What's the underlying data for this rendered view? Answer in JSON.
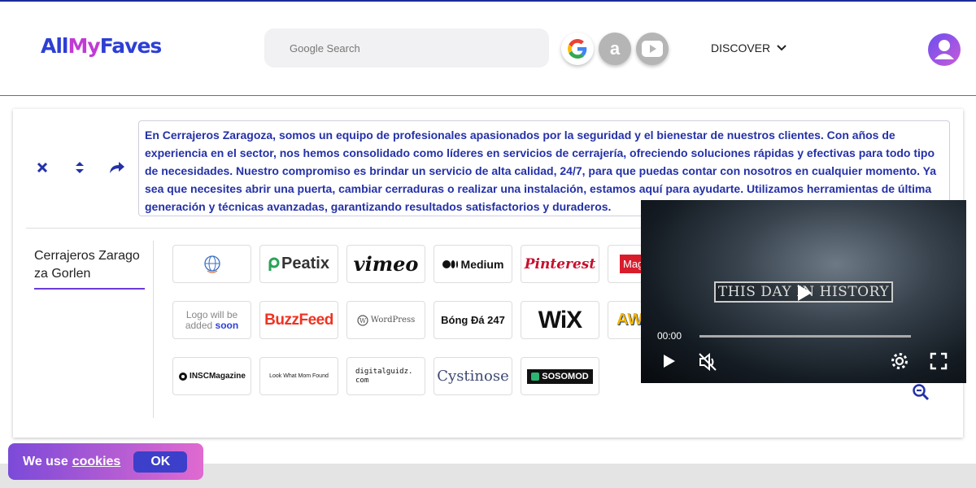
{
  "header": {
    "logo": {
      "part1": "All",
      "part2": "My",
      "part3": "Faves"
    },
    "search_placeholder": "Google Search",
    "engines": [
      {
        "name": "google",
        "icon": "google-icon"
      },
      {
        "name": "amazon",
        "icon": "amazon-icon"
      },
      {
        "name": "youtube",
        "icon": "youtube-icon"
      }
    ],
    "discover_label": "DISCOVER"
  },
  "card": {
    "tool_icons": [
      "close-icon",
      "sort-icon",
      "share-icon"
    ],
    "description": "En Cerrajeros Zaragoza, somos un equipo de profesionales apasionados por la seguridad y el bienestar de nuestros clientes. Con años de experiencia en el sector, nos hemos consolidado como líderes en servicios de cerrajería, ofreciendo soluciones rápidas y efectivas para todo tipo de necesidades. Nuestro compromiso es brindar un servicio de alta calidad, 24/7, para que puedas contar con nosotros en cualquier momento. Ya sea que necesites abrir una puerta, cambiar cerraduras o realizar una instalación, estamos aquí para ayudarte. Utilizamos herramientas de última generación y técnicas avanzadas, garantizando resultados satisfactorios y duraderos.",
    "tab_label": "Cerrajeros Zaragoza Gorlen",
    "tiles": [
      {
        "label": "",
        "kind": "globe"
      },
      {
        "label": "Peatix",
        "kind": "peatix"
      },
      {
        "label": "vimeo",
        "kind": "vimeo"
      },
      {
        "label": "Medium",
        "kind": "medium"
      },
      {
        "label": "Pinterest",
        "kind": "pinterest"
      },
      {
        "label": "Mag",
        "kind": "mag"
      },
      {
        "label": "Logo will be added soon",
        "kind": "placeholder",
        "line1": "Logo will be",
        "line2a": "added ",
        "line2b": "soon"
      },
      {
        "label": "BuzzFeed",
        "kind": "buzzfeed"
      },
      {
        "label": "WordPress",
        "kind": "wordpress"
      },
      {
        "label": "Bóng Đá 247",
        "kind": "bongda"
      },
      {
        "label": "WiX",
        "kind": "wix"
      },
      {
        "label": "AW",
        "kind": "aw"
      },
      {
        "label": "INSCMagazine",
        "kind": "insc"
      },
      {
        "label": "Look What Mom Found",
        "kind": "lwmf"
      },
      {
        "label": "digitalguidz.com",
        "kind": "digital"
      },
      {
        "label": "Cystinose",
        "kind": "cystinose"
      },
      {
        "label": "SOSOMOD",
        "kind": "sosomod"
      }
    ]
  },
  "video": {
    "title": "THIS DAY IN HISTORY",
    "time": "00:00",
    "progress": 0
  },
  "cookie": {
    "text": "We use",
    "link": "cookies",
    "ok": "OK"
  },
  "colors": {
    "brand_blue": "#2d3fd4",
    "brand_purple": "#c03bd6",
    "description_text": "#2431a8",
    "header_border": "#b4458f"
  }
}
